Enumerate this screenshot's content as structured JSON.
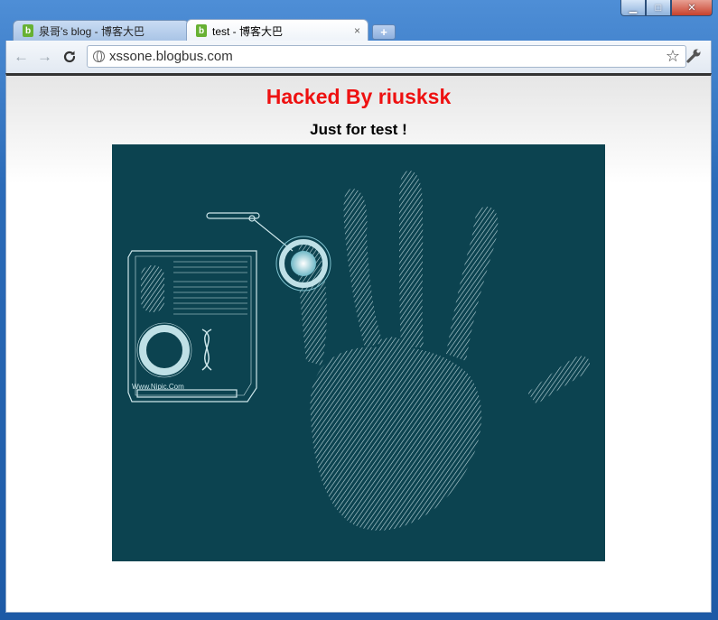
{
  "window": {
    "controls": {
      "minimize": "▁",
      "maximize": "□",
      "close": "✕"
    }
  },
  "tabs": [
    {
      "label": "泉哥's blog - 博客大巴",
      "favicon": "b",
      "active": false
    },
    {
      "label": "test - 博客大巴",
      "favicon": "b",
      "active": true
    }
  ],
  "new_tab_label": "+",
  "toolbar": {
    "back_icon": "←",
    "forward_icon": "→",
    "reload_icon": "C",
    "url": "xssone.blogbus.com",
    "bookmark_icon": "☆",
    "wrench_icon": "🔧"
  },
  "page": {
    "heading": "Hacked By riusksk",
    "subheading": "Just for test !",
    "image_watermark": "Www.Nipic.Com",
    "colors": {
      "heading": "#ee1111",
      "image_bg": "#0c4350"
    }
  }
}
